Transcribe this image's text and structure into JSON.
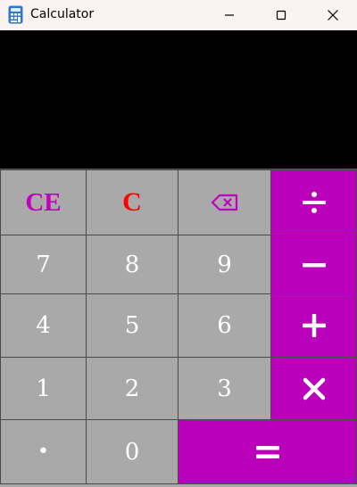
{
  "window": {
    "title": "Calculator",
    "app_icon": "calculator-icon",
    "controls": [
      "minimize-icon",
      "maximize-icon",
      "close-icon"
    ]
  },
  "display": {
    "value": ""
  },
  "keys": {
    "ce": "CE",
    "c": "C",
    "backspace": "backspace-icon",
    "divide": "divide-icon",
    "seven": "7",
    "eight": "8",
    "nine": "9",
    "subtract": "minus-icon",
    "four": "4",
    "five": "5",
    "six": "6",
    "add": "plus-icon",
    "one": "1",
    "two": "2",
    "three": "3",
    "multiply": "multiply-icon",
    "decimal": "•",
    "zero": "0",
    "equals": "equals-icon"
  },
  "colors": {
    "operator": "#bb00bb",
    "key": "#a9a9a9",
    "display_background": "#000000",
    "titlebar": "#fbf2f2",
    "ce_text": "#c000c0",
    "c_text": "#ff0000",
    "digit_text": "#ffffff"
  }
}
